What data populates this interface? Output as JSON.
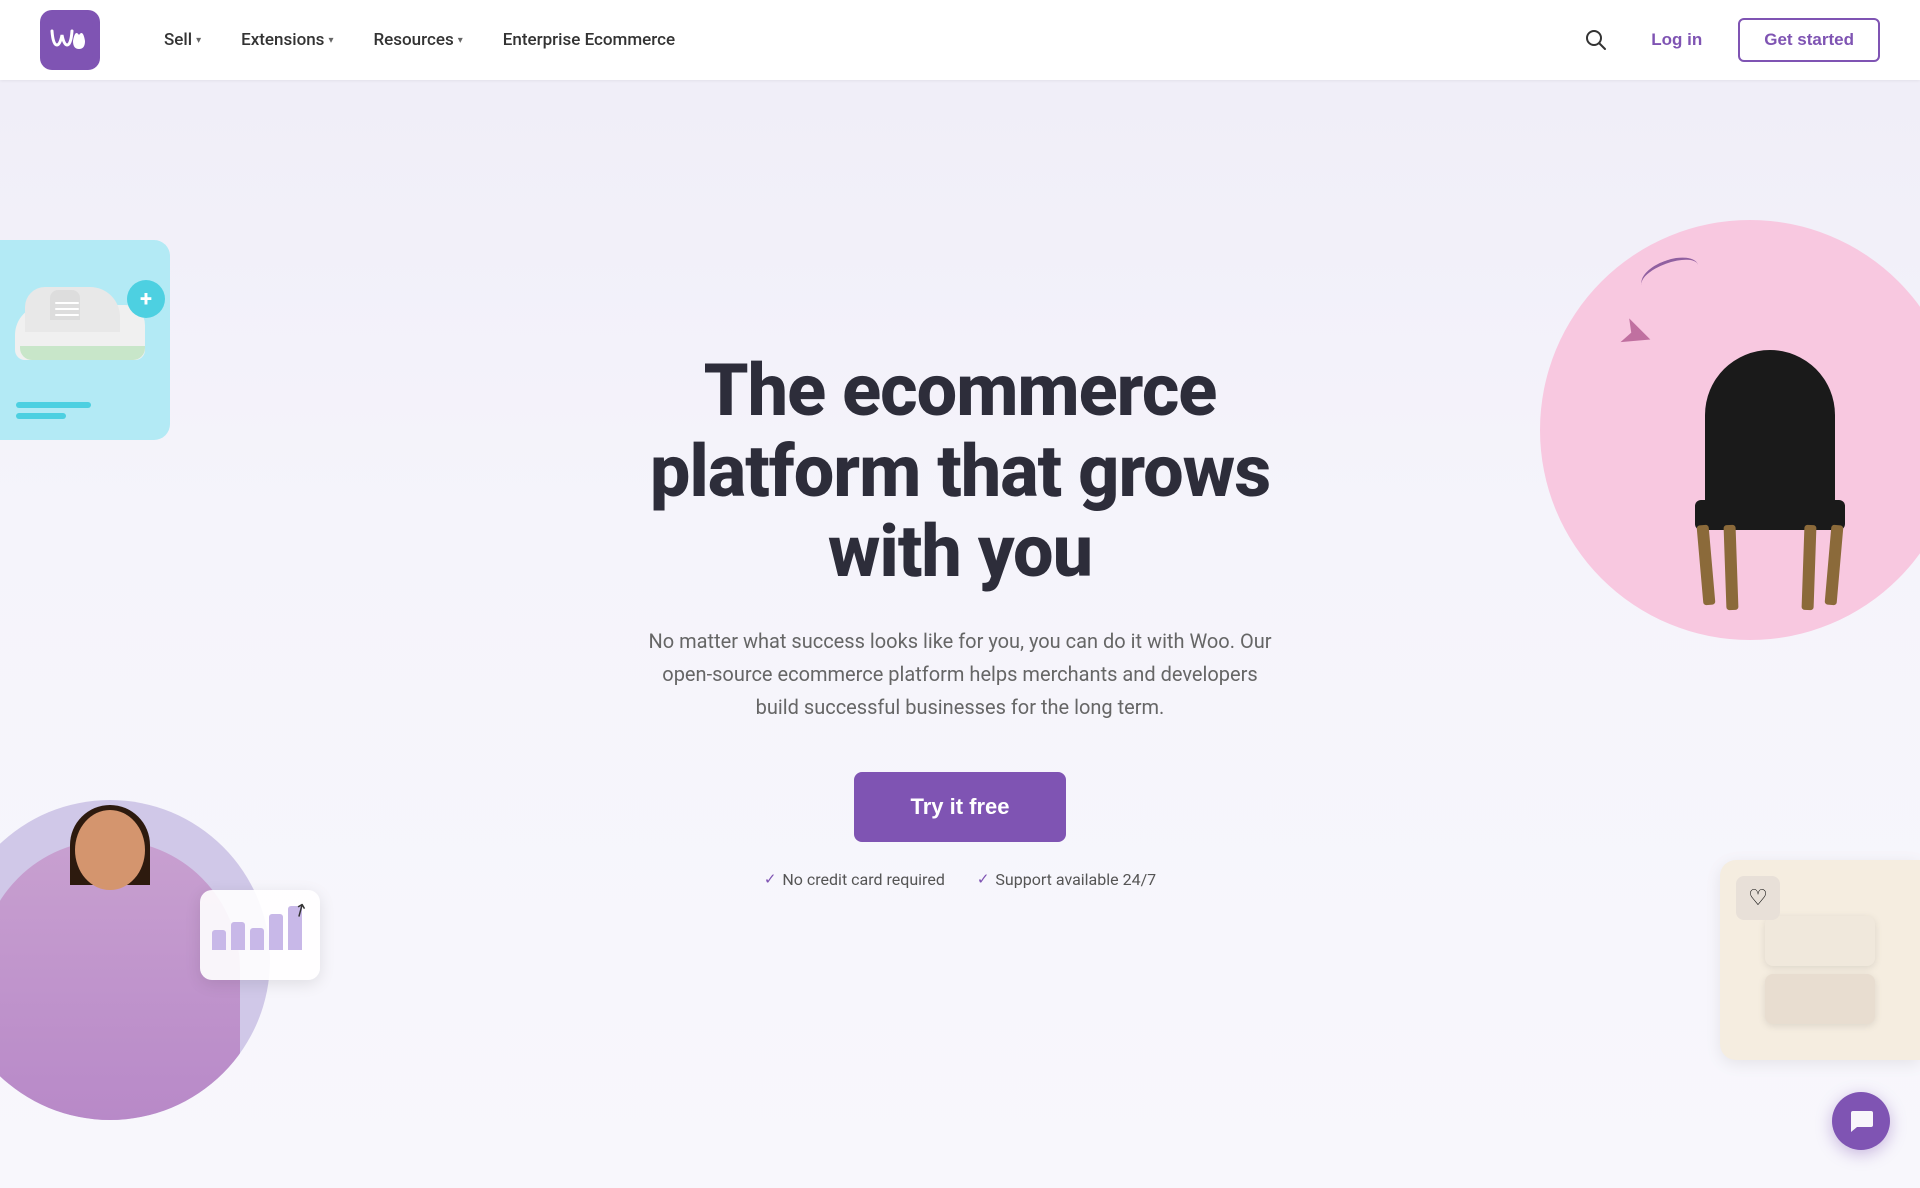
{
  "header": {
    "logo_text": "Woo",
    "nav": [
      {
        "label": "Sell",
        "has_dropdown": true
      },
      {
        "label": "Extensions",
        "has_dropdown": true
      },
      {
        "label": "Resources",
        "has_dropdown": true
      },
      {
        "label": "Enterprise Ecommerce",
        "has_dropdown": false
      }
    ],
    "login_label": "Log in",
    "get_started_label": "Get started"
  },
  "hero": {
    "title": "The ecommerce platform that grows with you",
    "subtitle": "No matter what success looks like for you, you can do it with Woo. Our open-source ecommerce platform helps merchants and developers build successful businesses for the long term.",
    "cta_label": "Try it free",
    "badge1": "No credit card required",
    "badge2": "Support available 24/7"
  },
  "colors": {
    "brand_purple": "#7f54b3",
    "brand_purple_dark": "#6d44a0",
    "accent_teal": "#4dd0e1",
    "accent_pink": "#f8c8e0",
    "bg_light": "#f0eef8"
  },
  "icons": {
    "search": "🔍",
    "check": "✓",
    "chat": "💬",
    "heart": "♡",
    "plus": "+"
  }
}
